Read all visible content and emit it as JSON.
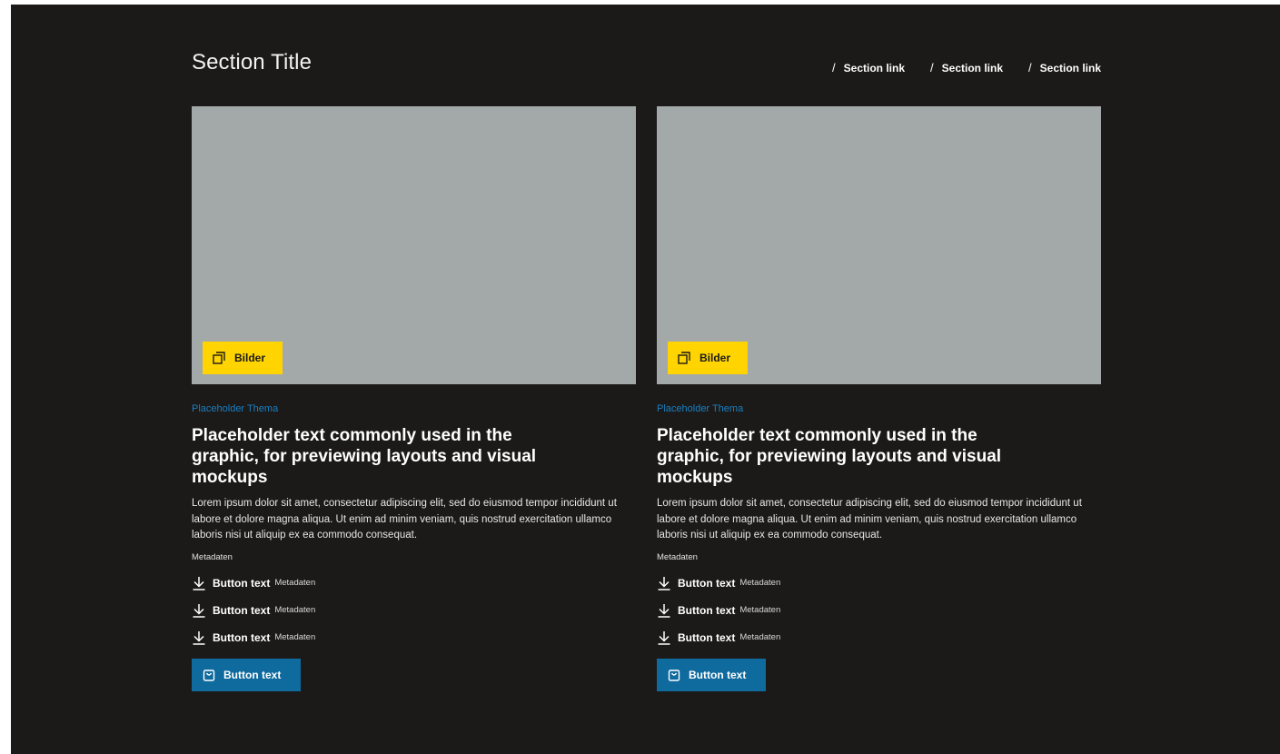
{
  "header": {
    "title": "Section Title",
    "links": [
      "Section link",
      "Section link",
      "Section link"
    ],
    "link_prefix": "/"
  },
  "cards": [
    {
      "badge_label": "Bilder",
      "badge_icon": "gallery-icon",
      "topic": "Placeholder Thema",
      "title": "Placeholder text commonly used in the graphic, for previewing layouts and visual mockups",
      "text": "Lorem ipsum dolor sit amet, consectetur adipiscing elit, sed do eiusmod tempor incididunt ut labore et dolore magna aliqua. Ut enim ad minim veniam, quis nostrud exercitation ullamco laboris nisi ut aliquip ex ea commodo consequat.",
      "meta": "Metadaten",
      "downloads": [
        {
          "label": "Button text",
          "meta": "Metadaten"
        },
        {
          "label": "Button text",
          "meta": "Metadaten"
        },
        {
          "label": "Button text",
          "meta": "Metadaten"
        }
      ],
      "button_label": "Button text",
      "button_icon": "shopping-bag-icon"
    },
    {
      "badge_label": "Bilder",
      "badge_icon": "gallery-icon",
      "topic": "Placeholder Thema",
      "title": "Placeholder text commonly used in the graphic, for previewing layouts and visual mockups",
      "text": "Lorem ipsum dolor sit amet, consectetur adipiscing elit, sed do eiusmod tempor incididunt ut labore et dolore magna aliqua. Ut enim ad minim veniam, quis nostrud exercitation ullamco laboris nisi ut aliquip ex ea commodo consequat.",
      "meta": "Metadaten",
      "downloads": [
        {
          "label": "Button text",
          "meta": "Metadaten"
        },
        {
          "label": "Button text",
          "meta": "Metadaten"
        },
        {
          "label": "Button text",
          "meta": "Metadaten"
        }
      ],
      "button_label": "Button text",
      "button_icon": "shopping-bag-icon"
    }
  ],
  "colors": {
    "background": "#1b1a19",
    "image_placeholder": "#a3a8a9",
    "badge": "#ffd400",
    "topic": "#1a7fc1",
    "primary_button": "#0f6a9e"
  }
}
